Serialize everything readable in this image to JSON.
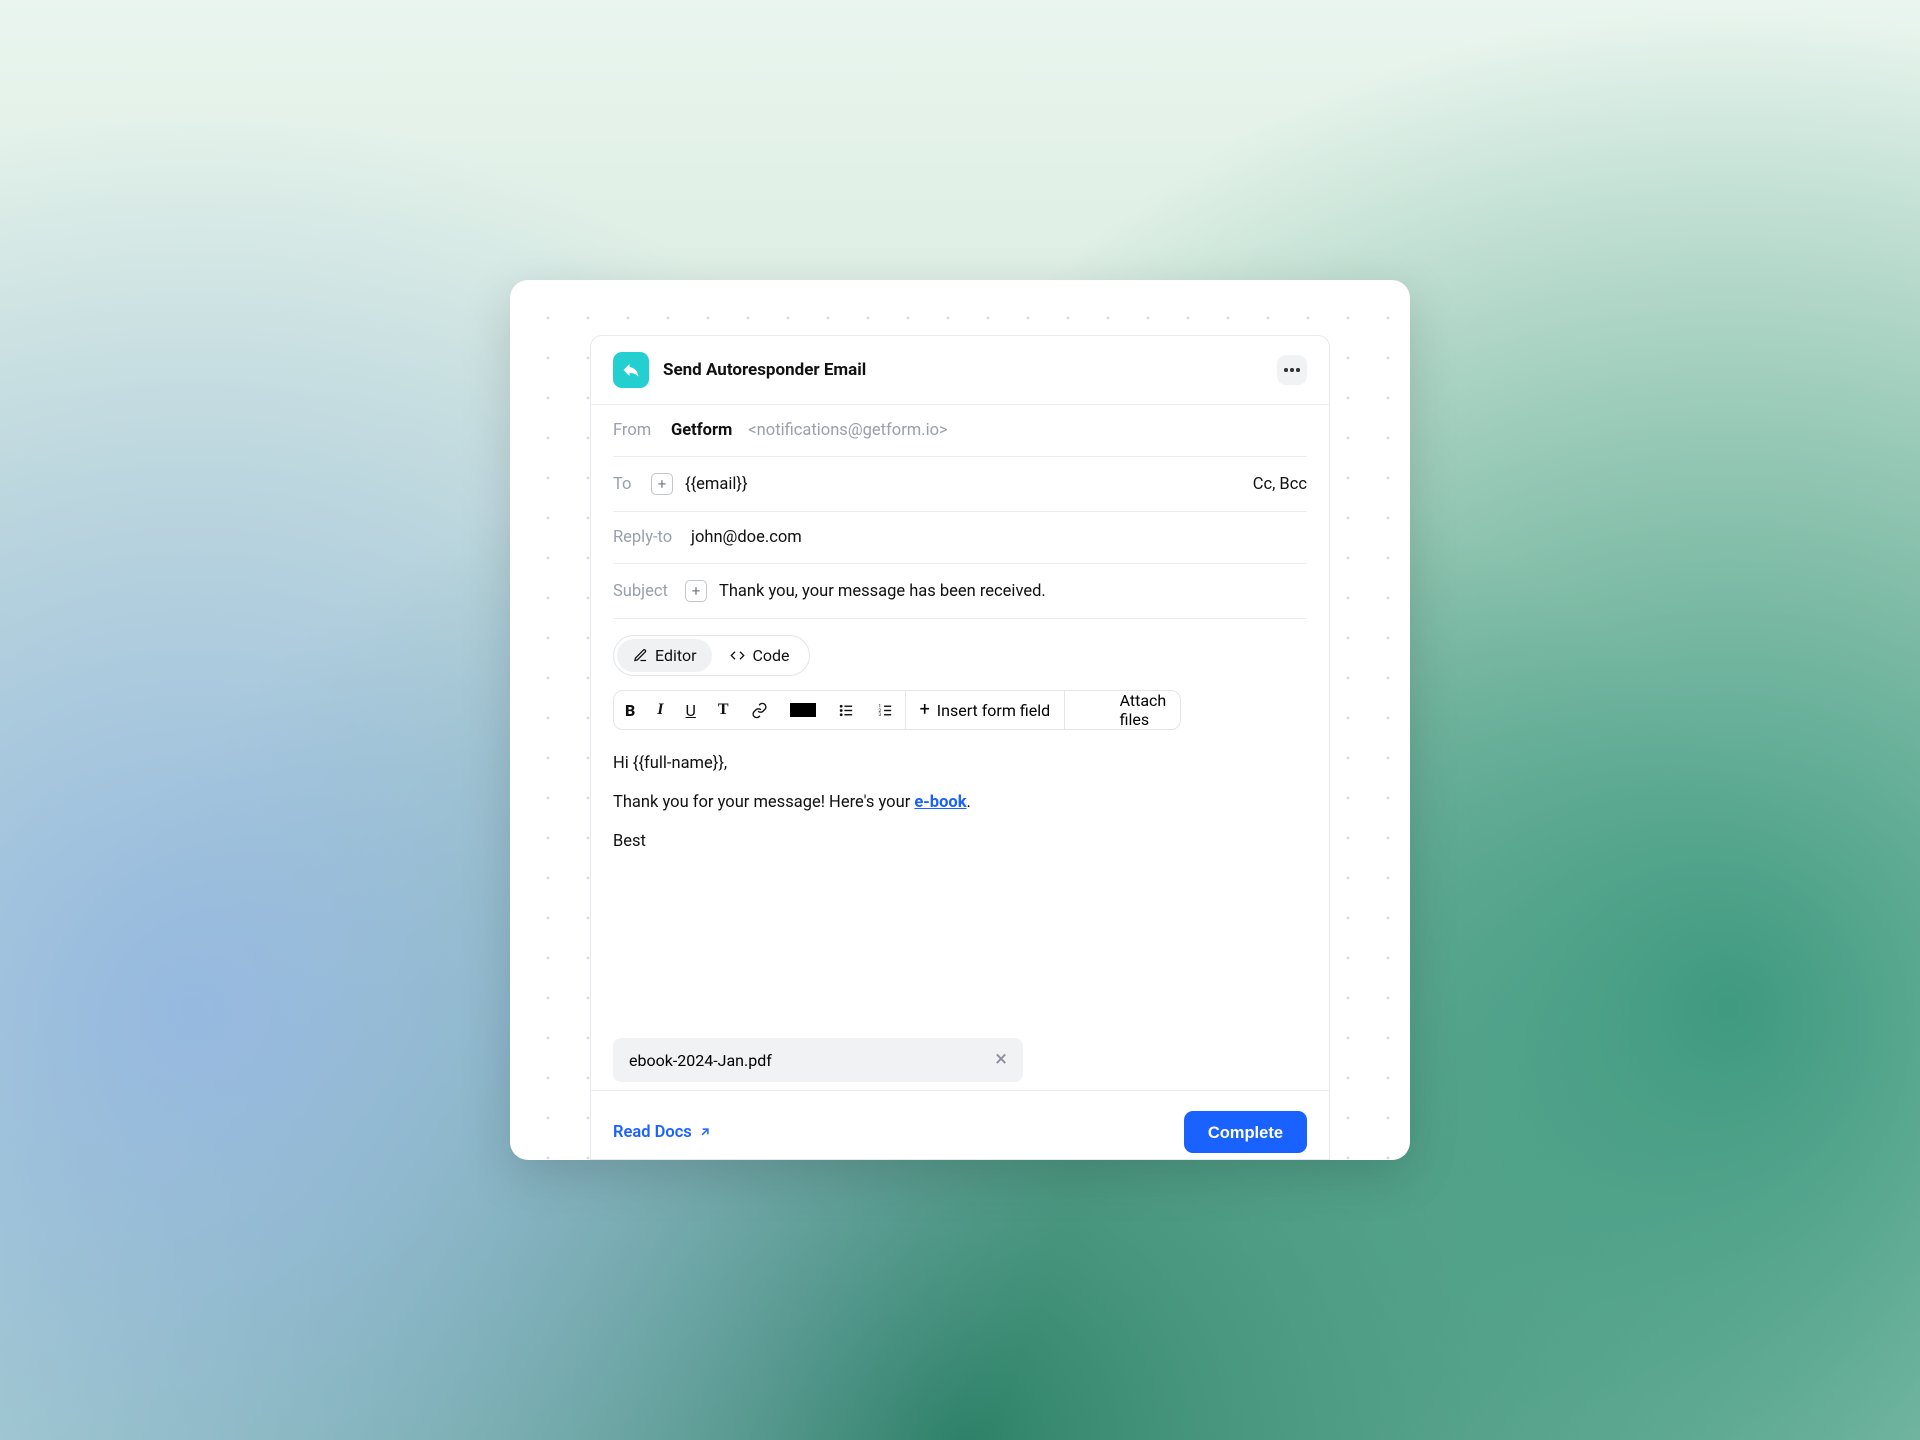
{
  "card": {
    "title": "Send Autoresponder Email",
    "icon": "reply-arrow-icon"
  },
  "from": {
    "label": "From",
    "name": "Getform",
    "address": "<notifications@getform.io>"
  },
  "to": {
    "label": "To",
    "value": "{{email}}",
    "ccbcc": "Cc, Bcc"
  },
  "reply_to": {
    "label": "Reply-to",
    "value": "john@doe.com"
  },
  "subject": {
    "label": "Subject",
    "value": "Thank you, your message has been received."
  },
  "tabs": {
    "editor": "Editor",
    "code": "Code"
  },
  "toolbar": {
    "insert_form_field": "Insert form field",
    "attach_files": "Attach files"
  },
  "body": {
    "line1": "Hi {{full-name}},",
    "line2_pre": "Thank you for your message! Here's your ",
    "line2_link": "e-book",
    "line2_post": ".",
    "line3": "Best"
  },
  "attachment": {
    "filename": "ebook-2024-Jan.pdf"
  },
  "footer": {
    "read_docs": "Read Docs",
    "complete": "Complete"
  }
}
